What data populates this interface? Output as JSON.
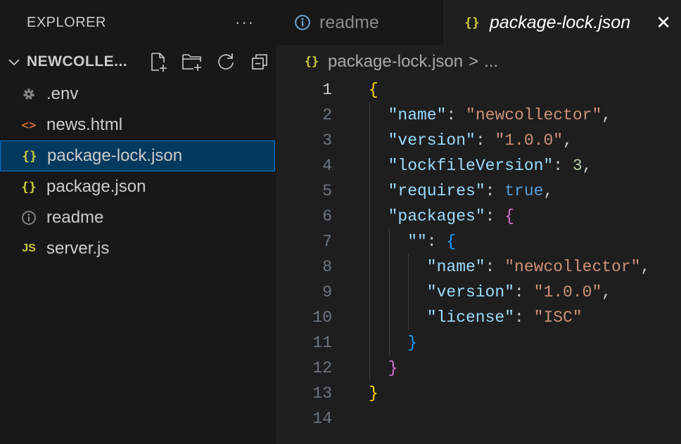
{
  "explorer": {
    "title": "EXPLORER",
    "more_label": "···",
    "folder_name": "NEWCOLLE...",
    "files": [
      {
        "name": ".env",
        "icon": "gear-icon"
      },
      {
        "name": "news.html",
        "icon": "html-icon"
      },
      {
        "name": "package-lock.json",
        "icon": "json-icon",
        "active": true
      },
      {
        "name": "package.json",
        "icon": "json-icon"
      },
      {
        "name": "readme",
        "icon": "info-icon"
      },
      {
        "name": "server.js",
        "icon": "js-icon"
      }
    ],
    "file_icon_glyphs": {
      "json": "{}",
      "html": "<>",
      "js": "JS"
    }
  },
  "tabs": [
    {
      "label": "readme",
      "icon": "info-icon",
      "active": false
    },
    {
      "label": "package-lock.json",
      "icon": "json-icon",
      "active": true
    }
  ],
  "breadcrumb": {
    "file": "package-lock.json",
    "separator": ">",
    "rest": "..."
  },
  "editor": {
    "line_numbers": [
      "1",
      "2",
      "3",
      "4",
      "5",
      "6",
      "7",
      "8",
      "9",
      "10",
      "11",
      "12",
      "13",
      "14"
    ],
    "lines": [
      {
        "tokens": [
          [
            "br1",
            "{"
          ]
        ]
      },
      {
        "tokens": [
          [
            "k",
            "\"name\""
          ],
          [
            "p",
            ": "
          ],
          [
            "s",
            "\"newcollector\""
          ],
          [
            "p",
            ","
          ]
        ]
      },
      {
        "tokens": [
          [
            "k",
            "\"version\""
          ],
          [
            "p",
            ": "
          ],
          [
            "s",
            "\"1.0.0\""
          ],
          [
            "p",
            ","
          ]
        ]
      },
      {
        "tokens": [
          [
            "k",
            "\"lockfileVersion\""
          ],
          [
            "p",
            ": "
          ],
          [
            "n",
            "3"
          ],
          [
            "p",
            ","
          ]
        ]
      },
      {
        "tokens": [
          [
            "k",
            "\"requires\""
          ],
          [
            "p",
            ": "
          ],
          [
            "b",
            "true"
          ],
          [
            "p",
            ","
          ]
        ]
      },
      {
        "tokens": [
          [
            "k",
            "\"packages\""
          ],
          [
            "p",
            ": "
          ],
          [
            "br2",
            "{"
          ]
        ]
      },
      {
        "tokens": [
          [
            "k",
            "\"\""
          ],
          [
            "p",
            ": "
          ],
          [
            "br3",
            "{"
          ]
        ]
      },
      {
        "tokens": [
          [
            "k",
            "\"name\""
          ],
          [
            "p",
            ": "
          ],
          [
            "s",
            "\"newcollector\""
          ],
          [
            "p",
            ","
          ]
        ]
      },
      {
        "tokens": [
          [
            "k",
            "\"version\""
          ],
          [
            "p",
            ": "
          ],
          [
            "s",
            "\"1.0.0\""
          ],
          [
            "p",
            ","
          ]
        ]
      },
      {
        "tokens": [
          [
            "k",
            "\"license\""
          ],
          [
            "p",
            ": "
          ],
          [
            "s",
            "\"ISC\""
          ]
        ]
      },
      {
        "tokens": [
          [
            "br3",
            "}"
          ]
        ]
      },
      {
        "tokens": [
          [
            "br2",
            "}"
          ]
        ]
      },
      {
        "tokens": [
          [
            "br1",
            "}"
          ]
        ]
      },
      {
        "tokens": []
      }
    ],
    "indent_levels": [
      0,
      1,
      1,
      1,
      1,
      1,
      2,
      3,
      3,
      3,
      2,
      1,
      0,
      0
    ],
    "current_line": 1
  },
  "colors": {
    "accent": "#0078d4",
    "selection": "#04395e",
    "json_icon": "#cbcb41",
    "html_icon": "#e37933"
  }
}
